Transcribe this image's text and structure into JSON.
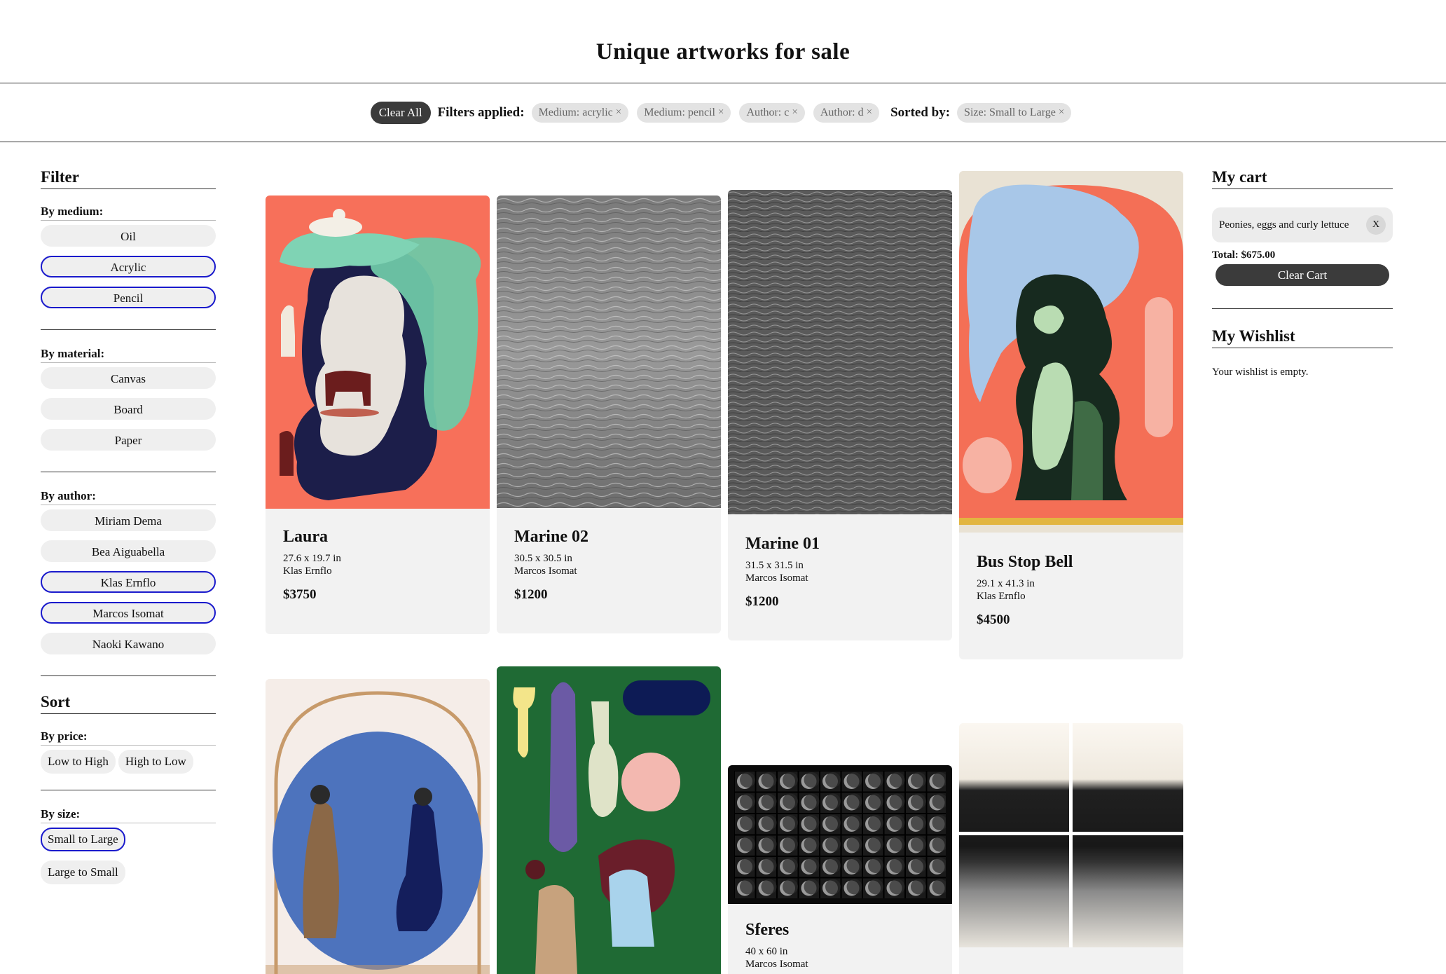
{
  "page_title": "Unique artworks for sale",
  "filterbar": {
    "clear_all": "Clear All",
    "filters_label": "Filters applied:",
    "filters": [
      {
        "label": "Medium: acrylic",
        "remove": "×"
      },
      {
        "label": "Medium: pencil",
        "remove": "×"
      },
      {
        "label": "Author: c",
        "remove": "×"
      },
      {
        "label": "Author: d",
        "remove": "×"
      }
    ],
    "sorted_label": "Sorted by:",
    "sort_chip": {
      "label": "Size: Small to Large",
      "remove": "×"
    }
  },
  "sidebar": {
    "filter_title": "Filter",
    "medium": {
      "label": "By medium:",
      "options": [
        "Oil",
        "Acrylic",
        "Pencil"
      ],
      "selected": [
        "Acrylic",
        "Pencil"
      ]
    },
    "material": {
      "label": "By material:",
      "options": [
        "Canvas",
        "Board",
        "Paper"
      ]
    },
    "author": {
      "label": "By author:",
      "options": [
        "Miriam Dema",
        "Bea Aiguabella",
        "Klas Ernflo",
        "Marcos Isomat",
        "Naoki Kawano"
      ],
      "selected": [
        "Klas Ernflo",
        "Marcos Isomat"
      ]
    },
    "sort_title": "Sort",
    "price": {
      "label": "By price:",
      "options": [
        "Low to High",
        "High to Low"
      ]
    },
    "size": {
      "label": "By size:",
      "options": [
        "Small to Large",
        "Large to Small"
      ],
      "selected": "Small to Large"
    }
  },
  "artworks": [
    {
      "title": "Laura",
      "dims": "27.6 x 19.7 in",
      "author": "Klas Ernflo",
      "price": "$3750"
    },
    {
      "title": "Marine 02",
      "dims": "30.5 x 30.5 in",
      "author": "Marcos Isomat",
      "price": "$1200"
    },
    {
      "title": "Marine 01",
      "dims": "31.5 x 31.5 in",
      "author": "Marcos Isomat",
      "price": "$1200"
    },
    {
      "title": "Bus Stop Bell",
      "dims": "29.1 x 41.3 in",
      "author": "Klas Ernflo",
      "price": "$4500"
    },
    {
      "title": "Sferes",
      "dims": "40 x 60 in",
      "author": "Marcos Isomat",
      "price": ""
    }
  ],
  "cart": {
    "title": "My cart",
    "items": [
      {
        "name": "Peonies, eggs and curly lettuce",
        "remove": "X"
      }
    ],
    "total": "Total: $675.00",
    "clear": "Clear Cart"
  },
  "wishlist": {
    "title": "My Wishlist",
    "empty": "Your wishlist is empty."
  },
  "colors": {
    "accent_dark": "#3b3b3b",
    "selected_border": "#1a1acc",
    "chip_bg": "#e3e3e3",
    "card_bg": "#f2f2f2"
  }
}
